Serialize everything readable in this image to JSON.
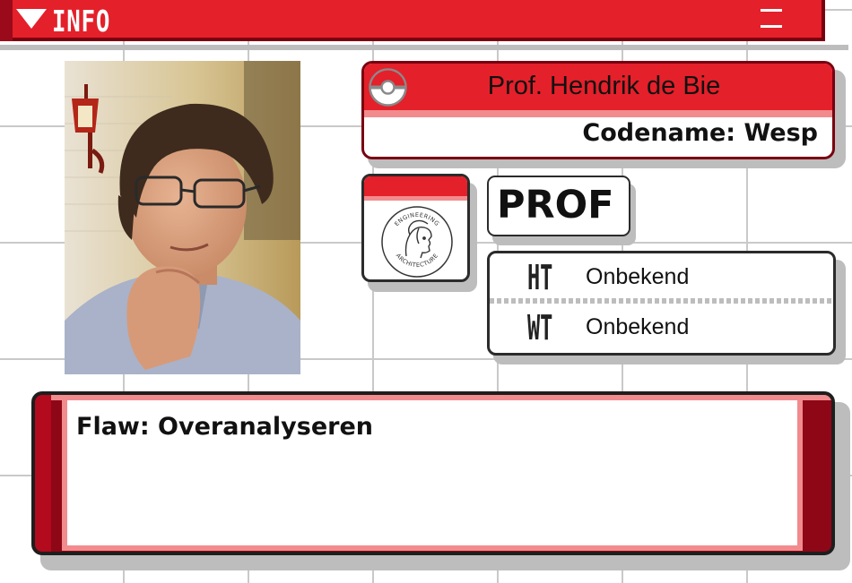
{
  "header": {
    "label": "INFO"
  },
  "profile": {
    "name": "Prof. Hendrik de Bie",
    "codename": "Codename: Wesp",
    "type": "PROF",
    "badge": {
      "logo_text_top": "ENGINEERING",
      "logo_text_bottom": "ARCHITECTURE"
    }
  },
  "stats": [
    {
      "label": "HT",
      "value": "Onbekend"
    },
    {
      "label": "WT",
      "value": "Onbekend"
    }
  ],
  "flaw": {
    "text": "Flaw: Overanalyseren"
  },
  "colors": {
    "primary_red": "#e4202a",
    "dark_red": "#7a0010",
    "pink_stripe": "#f28b8d",
    "grid": "#c9c9c9"
  }
}
